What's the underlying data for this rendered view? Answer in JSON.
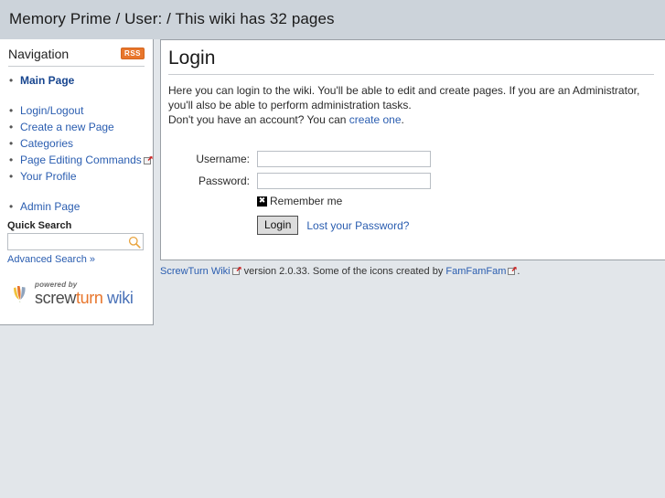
{
  "header": {
    "title": "Memory Prime / User: / This wiki has 32 pages"
  },
  "sidebar": {
    "nav_title": "Navigation",
    "rss_label": "RSS",
    "items": [
      {
        "label": "Main Page",
        "bold": true,
        "ext": false,
        "gap": false
      },
      {
        "label": "Login/Logout",
        "bold": false,
        "ext": false,
        "gap": true
      },
      {
        "label": "Create a new Page",
        "bold": false,
        "ext": false,
        "gap": false
      },
      {
        "label": "Categories",
        "bold": false,
        "ext": false,
        "gap": false
      },
      {
        "label": "Page Editing Commands",
        "bold": false,
        "ext": true,
        "gap": false
      },
      {
        "label": "Your Profile",
        "bold": false,
        "ext": false,
        "gap": false
      },
      {
        "label": "Admin Page",
        "bold": false,
        "ext": false,
        "gap": true
      }
    ],
    "quick_search_label": "Quick Search",
    "search_value": "",
    "search_placeholder": "",
    "advanced_search_label": "Advanced Search »",
    "logo": {
      "powered_by": "powered by",
      "screw": "screw",
      "turn": "turn",
      "wiki": " wiki"
    }
  },
  "main": {
    "title": "Login",
    "intro_line1": "Here you can login to the wiki. You'll be able to edit and create pages. If you are an Administrator, you'll also be able to perform administration tasks.",
    "intro_line2_pre": "Don't you have an account? You can ",
    "intro_line2_link": "create one",
    "intro_line2_post": ".",
    "form": {
      "username_label": "Username:",
      "username_value": "",
      "password_label": "Password:",
      "password_value": "",
      "remember_label": "Remember me",
      "remember_checked_glyph": "✖",
      "login_button": "Login",
      "lost_password_label": "Lost your Password?"
    }
  },
  "footer": {
    "wiki_link": "ScrewTurn Wiki",
    "version_text": " version 2.0.33. Some of the icons created by ",
    "famfamfam_link": "FamFamFam",
    "trailing": "."
  },
  "colors": {
    "header_bg": "#ccd3da",
    "body_bg": "#e2e6ea",
    "panel_bg": "#ffffff",
    "link": "#2a5db0",
    "rss_orange": "#e8762c",
    "logo_turn": "#e8762c",
    "logo_wiki": "#4a72b8"
  }
}
